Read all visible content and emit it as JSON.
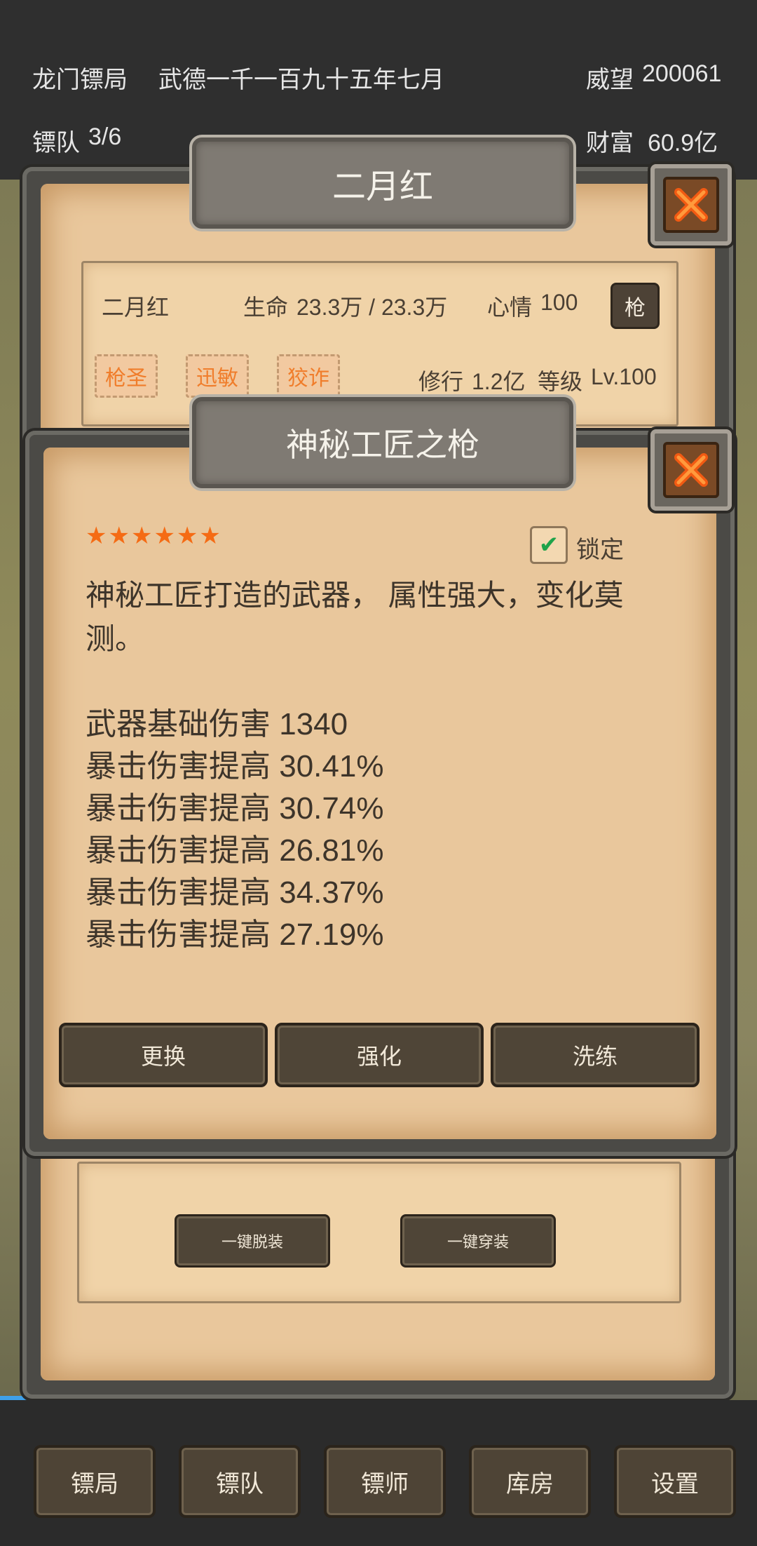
{
  "top": {
    "company": "龙门镖局",
    "date": "武德一千一百九十五年七月",
    "prestige_label": "威望",
    "prestige_value": "200061",
    "team_label": "镖队",
    "team_value": "3/6",
    "wealth_label": "财富",
    "wealth_value": "60.9亿"
  },
  "character": {
    "title": "二月红",
    "name": "二月红",
    "hp_label": "生命",
    "hp_value": "23.3万 / 23.3万",
    "mood_label": "心情",
    "mood_value": "100",
    "weapon_type": "枪",
    "tags": [
      "枪圣",
      "迅敏",
      "狡诈"
    ],
    "cultivation_label": "修行",
    "cultivation_value": "1.2亿",
    "level_label": "等级",
    "level_value": "Lv.100"
  },
  "item": {
    "title": "神秘工匠之枪",
    "stars": "★★★★★★",
    "lock_label": "锁定",
    "lock_checked": true,
    "description": "神秘工匠打造的武器， 属性强大，变化莫测。",
    "stats": [
      "武器基础伤害 1340",
      "暴击伤害提高 30.41%",
      "暴击伤害提高 30.74%",
      "暴击伤害提高 26.81%",
      "暴击伤害提高 34.37%",
      "暴击伤害提高 27.19%"
    ],
    "buttons": {
      "replace": "更换",
      "enhance": "强化",
      "refine": "洗练"
    }
  },
  "equip_actions": {
    "unequip_all": "一键脱装",
    "equip_all": "一键穿装"
  },
  "nav": {
    "escort_bureau": "镖局",
    "escort_team": "镖队",
    "escort_master": "镖师",
    "warehouse": "库房",
    "settings": "设置"
  },
  "colors": {
    "parchment": "#e9c79c",
    "star": "#f56b14",
    "tag_text": "#f07d2b",
    "button": "#4f4537",
    "check": "#1fa34a"
  }
}
